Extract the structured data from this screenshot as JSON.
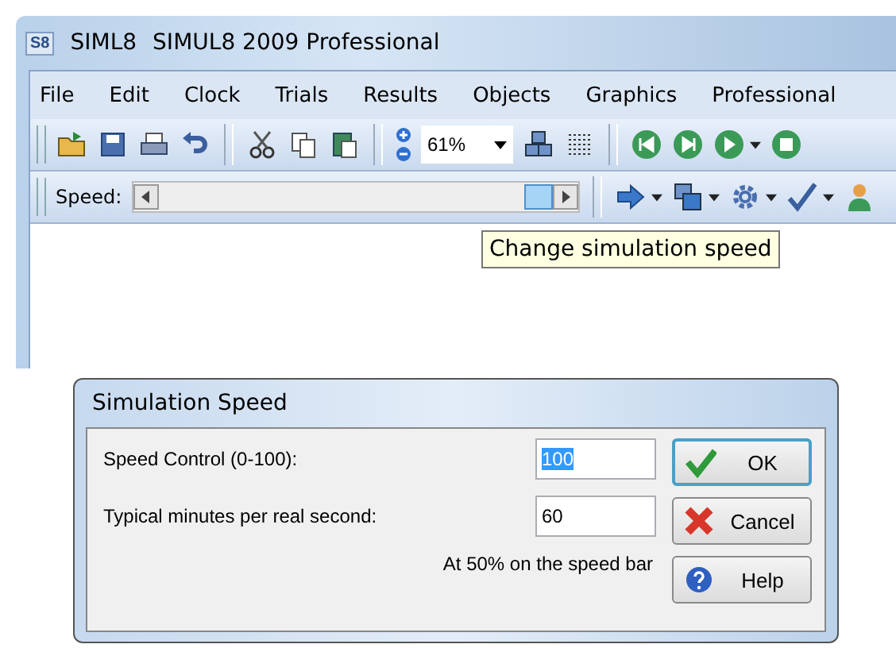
{
  "window": {
    "app_badge": "S8",
    "short_name": "SIML8",
    "title": "SIMUL8 2009 Professional"
  },
  "menu": [
    "File",
    "Edit",
    "Clock",
    "Trials",
    "Results",
    "Objects",
    "Graphics",
    "Professional"
  ],
  "toolbar": {
    "zoom": "61%"
  },
  "speed_bar": {
    "label": "Speed:"
  },
  "tooltip": "Change simulation speed",
  "dialog": {
    "title": "Simulation Speed",
    "fields": [
      {
        "label": "Speed Control (0-100):",
        "value": "100",
        "selected": true
      },
      {
        "label": "Typical minutes per real second:",
        "value": "60",
        "selected": false
      }
    ],
    "note": "At 50% on the speed bar",
    "buttons": [
      {
        "kind": "ok",
        "label": "OK",
        "selected": true
      },
      {
        "kind": "cancel",
        "label": "Cancel",
        "selected": false
      },
      {
        "kind": "help",
        "label": "Help",
        "selected": false
      }
    ]
  }
}
